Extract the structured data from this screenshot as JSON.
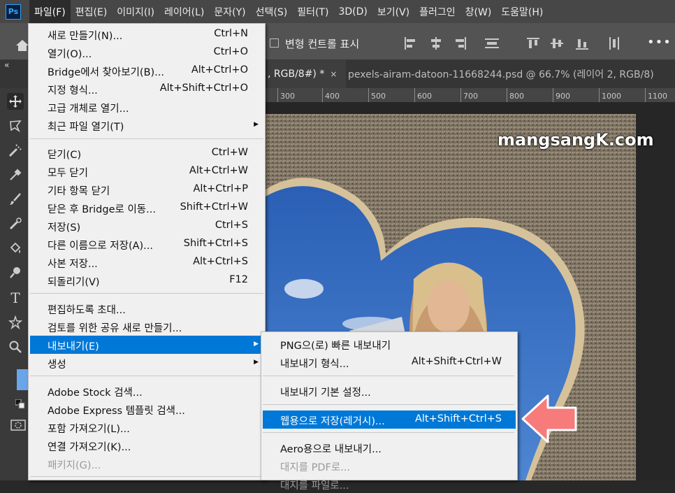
{
  "app_icon": "Ps",
  "menubar": [
    "파일(F)",
    "편집(E)",
    "이미지(I)",
    "레이어(L)",
    "문자(Y)",
    "선택(S)",
    "필터(T)",
    "3D(D)",
    "보기(V)",
    "플러그인",
    "창(W)",
    "도움말(H)"
  ],
  "options_bar": {
    "transform_controls_label": "변형 컨트롤 표시",
    "more": "•••"
  },
  "tabs": [
    {
      "title": ", RGB/8#) *",
      "close": "×"
    },
    {
      "title": "pexels-airam-datoon-11668244.psd @ 66.7% (레이어 2, RGB/8)"
    }
  ],
  "collapse_glyph": "«",
  "ruler_ticks": [
    "300",
    "400",
    "500",
    "600",
    "700",
    "800",
    "900",
    "1000",
    "1100"
  ],
  "watermark": "mangsangK.com",
  "file_menu": {
    "items": [
      {
        "label": "새로 만들기(N)...",
        "shortcut": "Ctrl+N"
      },
      {
        "label": "열기(O)...",
        "shortcut": "Ctrl+O"
      },
      {
        "label": "Bridge에서 찾아보기(B)...",
        "shortcut": "Alt+Ctrl+O"
      },
      {
        "label": "지정 형식...",
        "shortcut": "Alt+Shift+Ctrl+O"
      },
      {
        "label": "고급 개체로 열기...",
        "shortcut": ""
      },
      {
        "label": "최근 파일 열기(T)",
        "shortcut": "",
        "submenu": true
      },
      {
        "label": "닫기(C)",
        "shortcut": "Ctrl+W"
      },
      {
        "label": "모두 닫기",
        "shortcut": "Alt+Ctrl+W"
      },
      {
        "label": "기타 항목 닫기",
        "shortcut": "Alt+Ctrl+P"
      },
      {
        "label": "닫은 후 Bridge로 이동...",
        "shortcut": "Shift+Ctrl+W"
      },
      {
        "label": "저장(S)",
        "shortcut": "Ctrl+S"
      },
      {
        "label": "다른 이름으로 저장(A)...",
        "shortcut": "Shift+Ctrl+S"
      },
      {
        "label": "사본 저장...",
        "shortcut": "Alt+Ctrl+S"
      },
      {
        "label": "되돌리기(V)",
        "shortcut": "F12"
      },
      {
        "label": "편집하도록 초대...",
        "shortcut": ""
      },
      {
        "label": "검토를 위한 공유 새로 만들기...",
        "shortcut": ""
      },
      {
        "label": "내보내기(E)",
        "shortcut": "",
        "submenu": true,
        "highlighted": true
      },
      {
        "label": "생성",
        "shortcut": "",
        "submenu": true
      },
      {
        "label": "Adobe Stock 검색...",
        "shortcut": ""
      },
      {
        "label": "Adobe Express 템플릿 검색...",
        "shortcut": ""
      },
      {
        "label": "포함 가져오기(L)...",
        "shortcut": ""
      },
      {
        "label": "연결 가져오기(K)...",
        "shortcut": ""
      },
      {
        "label": "패키지(G)...",
        "shortcut": "",
        "disabled": true
      }
    ]
  },
  "export_submenu": {
    "items": [
      {
        "label": "PNG으(로) 빠른 내보내기",
        "shortcut": ""
      },
      {
        "label": "내보내기 형식...",
        "shortcut": "Alt+Shift+Ctrl+W"
      },
      {
        "label": "내보내기 기본 설정...",
        "shortcut": ""
      },
      {
        "label": "웹용으로 저장(레거시)...",
        "shortcut": "Alt+Shift+Ctrl+S",
        "highlighted": true
      },
      {
        "label": "Aero용으로 내보내기...",
        "shortcut": ""
      },
      {
        "label": "대지를 PDF로...",
        "shortcut": "",
        "disabled": true
      },
      {
        "label": "대지를 파일로...",
        "shortcut": "",
        "disabled": true
      }
    ]
  },
  "arrow_color": "#f77b7b",
  "highlight_color": "#0078d7"
}
